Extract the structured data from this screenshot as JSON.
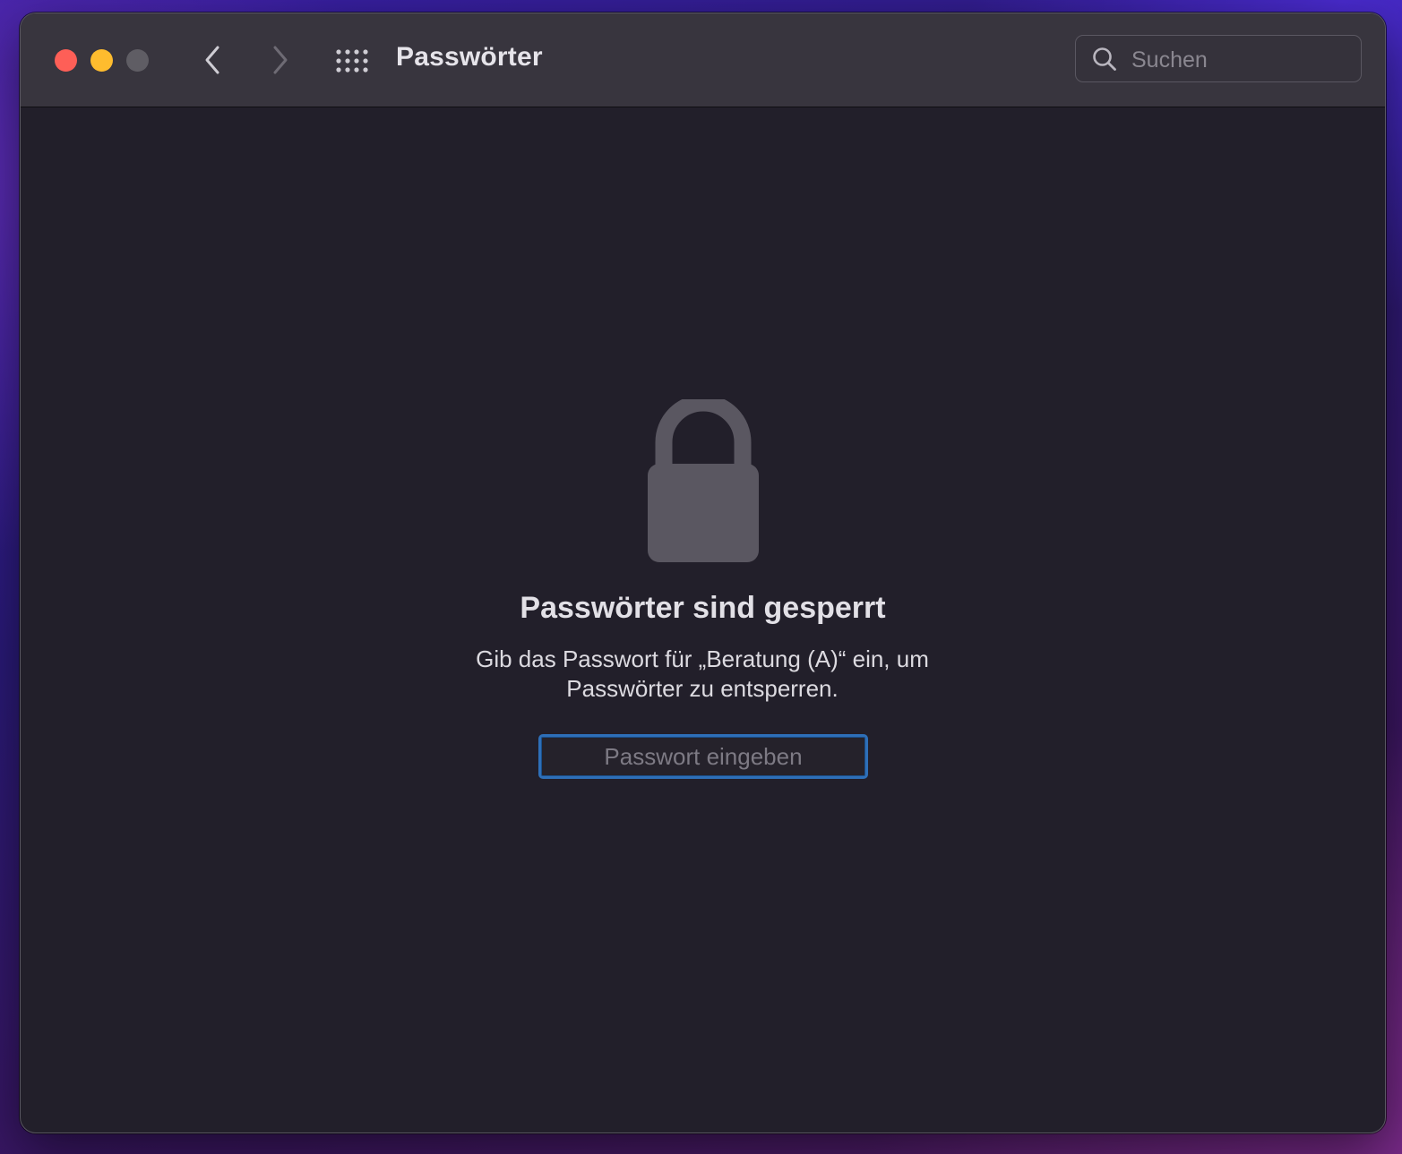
{
  "window": {
    "title": "Passwörter",
    "controls": {
      "close_color": "#fe5f57",
      "minimize_color": "#febc2e",
      "zoom_color": "#5f5d64"
    },
    "nav": {
      "back_icon": "chevron-left-icon",
      "forward_icon": "chevron-right-icon",
      "grid_icon": "grid-icon"
    },
    "search": {
      "placeholder": "Suchen",
      "value": ""
    }
  },
  "main": {
    "lock_icon": "lock-icon",
    "heading": "Passwörter sind gesperrt",
    "message": "Gib das Passwort für „Beratung (A)“ ein, um Passwörter zu entsperren.",
    "password_field": {
      "placeholder": "Passwort eingeben",
      "value": ""
    }
  },
  "colors": {
    "accent_focus_ring": "#2e6fb8",
    "window_bg": "#221f2a",
    "titlebar_bg": "#38353e"
  }
}
